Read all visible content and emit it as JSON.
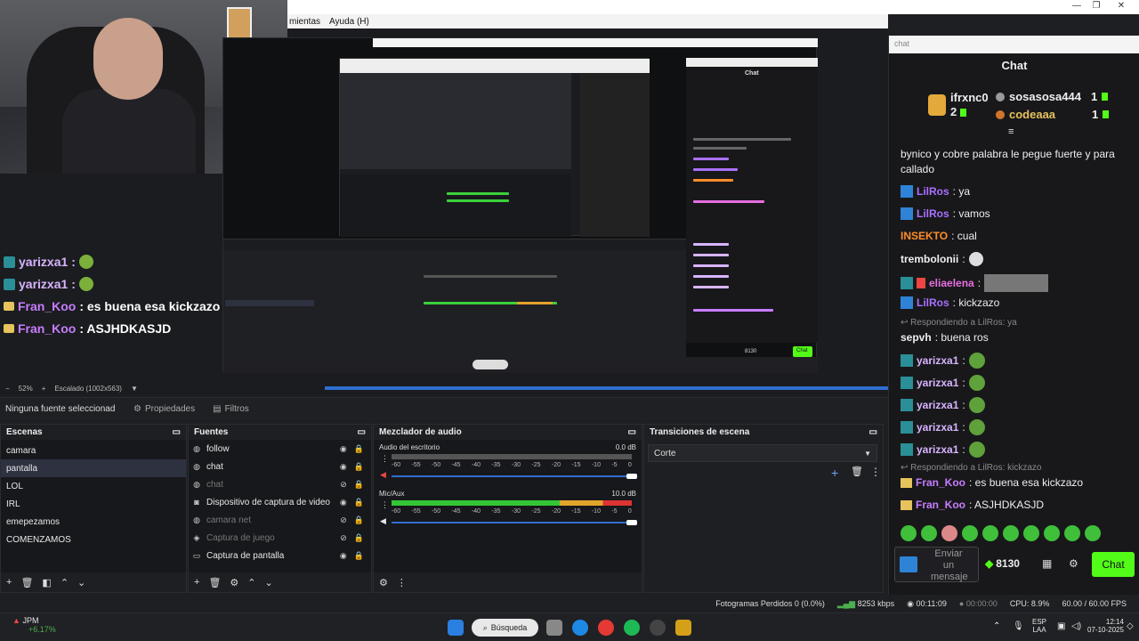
{
  "window": {
    "menu": [
      "mientas",
      "Ayuda (H)"
    ],
    "controls": [
      "—",
      "❐",
      "✕"
    ]
  },
  "overlay_chat": [
    {
      "user": "yarizxa1",
      "text": ""
    },
    {
      "user": "yarizxa1",
      "text": ""
    },
    {
      "user": "Fran_Koo",
      "text": ": es buena esa kickzazo"
    },
    {
      "user": "Fran_Koo",
      "text": ": ASJHDKASJD"
    }
  ],
  "nested_preview": {
    "chat_title": "Chat",
    "chat_button": "Chat",
    "points": "8130"
  },
  "zoombar": {
    "zoom": "52%",
    "scale_label": "Escalado (1002x563)"
  },
  "propbar": {
    "no_source": "Ninguna fuente seleccionad",
    "properties": "Propiedades",
    "filters": "Filtros"
  },
  "scenes": {
    "title": "Escenas",
    "items": [
      "camara",
      "pantalla",
      "LOL",
      "IRL",
      "emepezamos",
      "COMENZAMOS"
    ],
    "selected": "pantalla"
  },
  "sources": {
    "title": "Fuentes",
    "items": [
      {
        "label": "follow",
        "icon": "globe-icon",
        "visible": true
      },
      {
        "label": "chat",
        "icon": "globe-icon",
        "visible": true
      },
      {
        "label": "chat",
        "icon": "globe-icon",
        "visible": false
      },
      {
        "label": "Dispositivo de captura de video",
        "icon": "camera-icon",
        "visible": true
      },
      {
        "label": "camara net",
        "icon": "globe-icon",
        "visible": false
      },
      {
        "label": "Captura de juego",
        "icon": "gamepad-icon",
        "visible": false
      },
      {
        "label": "Captura de pantalla",
        "icon": "monitor-icon",
        "visible": true
      }
    ]
  },
  "mixer": {
    "title": "Mezclador de audio",
    "channels": [
      {
        "name": "Audio del escritorio",
        "db": "0.0 dB",
        "level": 0.0
      },
      {
        "name": "Mic/Aux",
        "db": "10.0 dB",
        "level": 0.9
      }
    ],
    "scale": [
      "-60",
      "-55",
      "-50",
      "-45",
      "-40",
      "-35",
      "-30",
      "-25",
      "-20",
      "-15",
      "-10",
      "-5",
      "0"
    ]
  },
  "transitions": {
    "title": "Transiciones de escena",
    "selected": "Corte"
  },
  "statusbar": {
    "dropped": "Fotogramas Perdidos 0 (0.0%)",
    "bitrate": "8253 kbps",
    "stream_time": "00:11:09",
    "rec_time": "00:00:00",
    "cpu": "CPU: 8.9%",
    "fps": "60.00 / 60.00 FPS"
  },
  "taskbar": {
    "stock_name": "JPM",
    "stock_change": "+6.17%",
    "search": "Búsqueda",
    "lang": "ESP",
    "lang2": "LAA",
    "time": "12:14",
    "date": "07-10-2025"
  },
  "chat": {
    "url": "chat",
    "title": "Chat",
    "leaderboard": [
      {
        "name": "ifrxnc0",
        "count": "2",
        "rank_color": "#e3a93a"
      },
      {
        "name": "sosasosa444",
        "count": "1",
        "rank_color": "#9a9a9a"
      },
      {
        "name": "codeaaa",
        "count": "1",
        "rank_color": "#d0742c"
      }
    ],
    "messages": [
      {
        "type": "text",
        "user": "",
        "text": "bynico y cobre palabra le pegue fuerte y para"
      },
      {
        "type": "text",
        "user": "",
        "text": "callado"
      },
      {
        "type": "msg",
        "user": "LilRos",
        "color": "#a970ff",
        "text": ": ya"
      },
      {
        "type": "msg",
        "user": "LilRos",
        "color": "#a970ff",
        "text": ": vamos"
      },
      {
        "type": "msg",
        "user": "INSEKTO",
        "color": "#ff8c2a",
        "text": ": cual"
      },
      {
        "type": "msg",
        "user": "trembolonii",
        "color": "#eeeeee",
        "text": ":"
      },
      {
        "type": "msg",
        "user": "eliaelena",
        "color": "#e86fe0",
        "text": ":"
      },
      {
        "type": "msg",
        "user": "LilRos",
        "color": "#a970ff",
        "text": ": kickzazo"
      },
      {
        "type": "reply",
        "text": "Respondiendo a LilRos: ya"
      },
      {
        "type": "msg",
        "user": "sepvh",
        "color": "#eeeeee",
        "text": ": buena ros"
      },
      {
        "type": "msg",
        "user": "yarizxa1",
        "color": "#d8b4ff",
        "text": ":"
      },
      {
        "type": "msg",
        "user": "yarizxa1",
        "color": "#d8b4ff",
        "text": ":"
      },
      {
        "type": "msg",
        "user": "yarizxa1",
        "color": "#d8b4ff",
        "text": ":"
      },
      {
        "type": "msg",
        "user": "yarizxa1",
        "color": "#d8b4ff",
        "text": ":"
      },
      {
        "type": "msg",
        "user": "yarizxa1",
        "color": "#d8b4ff",
        "text": ":"
      },
      {
        "type": "reply",
        "text": "Respondiendo a LilRos: kickzazo"
      },
      {
        "type": "msg",
        "user": "Fran_Koo",
        "color": "#c77dff",
        "text": ": es buena esa kickzazo"
      },
      {
        "type": "msg",
        "user": "Fran_Koo",
        "color": "#c77dff",
        "text": ": ASJHDKASJD"
      }
    ],
    "input_placeholder": "Enviar un mensaje",
    "points": "8130",
    "send_label": "Chat"
  }
}
